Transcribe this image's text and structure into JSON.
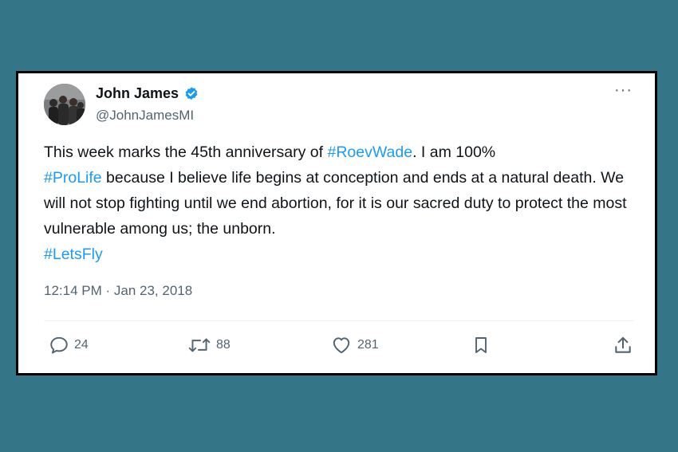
{
  "colors": {
    "page_background": "#347587",
    "card_background": "#ffffff",
    "card_border": "#000000",
    "text_primary": "#0f1419",
    "text_secondary": "#536471",
    "link": "#1d9bf0",
    "verified_badge": "#1d9bf0"
  },
  "tweet": {
    "author": {
      "name": "John James",
      "handle": "@JohnJamesMI",
      "verified": true,
      "avatar_icon": "group-photo-avatar"
    },
    "more_label": "···",
    "text_segments": {
      "s1": "This week marks the 45th anniversary of ",
      "h1": "#RoevWade",
      "s2": ". I am 100% ",
      "h2": "#ProLife",
      "s3": " because I believe life begins at conception and ends at a natural death. We will not stop fighting until we end abortion, for it is our sacred duty to protect the most vulnerable among us; the unborn. ",
      "h3": "#LetsFly"
    },
    "timestamp": "12:14 PM · Jan 23, 2018",
    "actions": {
      "replies": {
        "icon": "reply-icon",
        "count": "24"
      },
      "retweets": {
        "icon": "retweet-icon",
        "count": "88"
      },
      "likes": {
        "icon": "heart-icon",
        "count": "281"
      },
      "bookmark": {
        "icon": "bookmark-icon"
      },
      "share": {
        "icon": "share-icon"
      }
    }
  }
}
